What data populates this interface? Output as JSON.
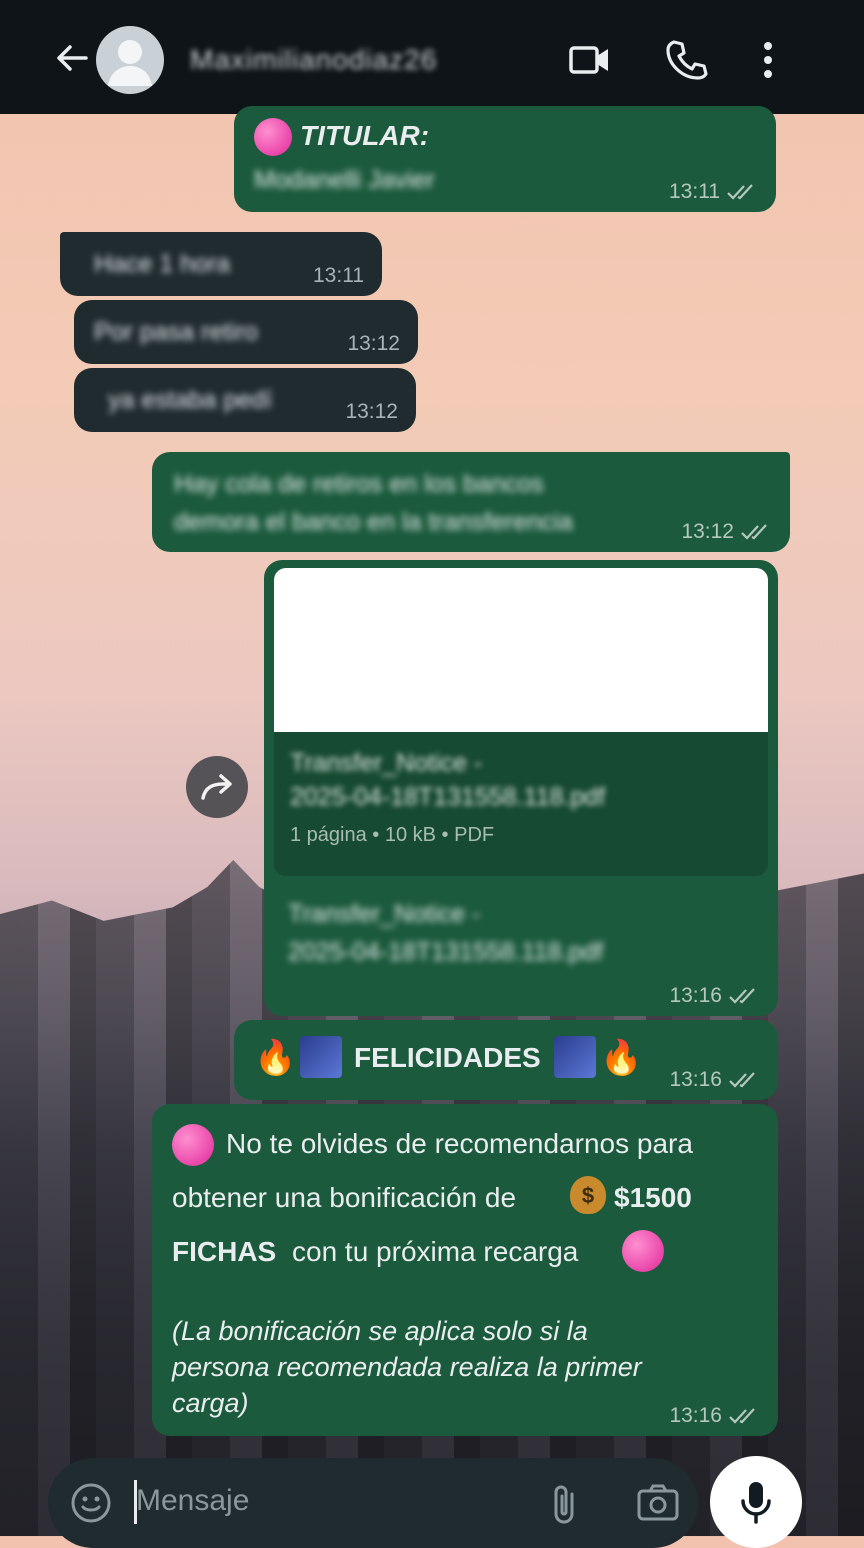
{
  "header": {
    "contact_name": "Maximilianodiaz26",
    "icons": [
      "back-arrow-icon",
      "avatar",
      "video-call-icon",
      "phone-call-icon",
      "more-vert-icon"
    ]
  },
  "messages": [
    {
      "id": "m1",
      "direction": "out",
      "title": "TITULAR:",
      "text": "Modanelli Javier",
      "time": "13:11",
      "status": "read"
    },
    {
      "id": "m2",
      "direction": "in",
      "text": "Hace 1 hora",
      "time": "13:11"
    },
    {
      "id": "m3",
      "direction": "in",
      "text": "Por pasa retiro",
      "time": "13:12"
    },
    {
      "id": "m4",
      "direction": "in",
      "text": "ya estaba pedí",
      "time": "13:12"
    },
    {
      "id": "m5",
      "direction": "out",
      "line1": "Hay cola de retiros en los bancos",
      "line2": "demora el banco en la transferencia",
      "time": "13:12",
      "status": "read"
    },
    {
      "id": "m6",
      "direction": "out",
      "doc_name_1": "Transfer_Notice -",
      "doc_name_2": "2025-04-18T131558.118.pdf",
      "doc_meta": "1 página • 10 kB • PDF",
      "caption_1": "Transfer_Notice -",
      "caption_2": "2025-04-18T131558.118.pdf",
      "time": "13:16",
      "status": "read"
    },
    {
      "id": "m7",
      "direction": "out",
      "text": "FELICIDADES",
      "time": "13:16",
      "status": "read"
    },
    {
      "id": "m8",
      "direction": "out",
      "line1": "No te olvides de recomendarnos para",
      "line2a": "obtener una bonificación de",
      "line2b": "$1500",
      "line3a": "FICHAS",
      "line3b": "con tu próxima recarga",
      "note1": "(La bonificación se aplica solo si la",
      "note2": "persona recomendada realiza la primer",
      "note3": "carga)",
      "time": "13:16",
      "status": "read"
    }
  ],
  "composer": {
    "placeholder": "Mensaje"
  },
  "colors": {
    "header_bg": "#0e1418",
    "outgoing_bubble": "#1b5a3c",
    "incoming_bubble": "#1f2b2f",
    "read_ticks": "#b6c8bd"
  }
}
